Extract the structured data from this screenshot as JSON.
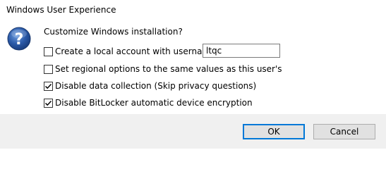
{
  "window": {
    "title": "Windows User Experience"
  },
  "icon": {
    "name": "question-icon",
    "color": "#2b5aa8"
  },
  "prompt": "Customize Windows installation?",
  "options": [
    {
      "label": "Create a local account with username:",
      "checked": false
    },
    {
      "label": "Set regional options to the same values as this user's",
      "checked": false
    },
    {
      "label": "Disable data collection (Skip privacy questions)",
      "checked": true
    },
    {
      "label": "Disable BitLocker automatic device encryption",
      "checked": true
    }
  ],
  "username_field": {
    "value": "ltqc"
  },
  "buttons": {
    "ok": "OK",
    "cancel": "Cancel"
  }
}
